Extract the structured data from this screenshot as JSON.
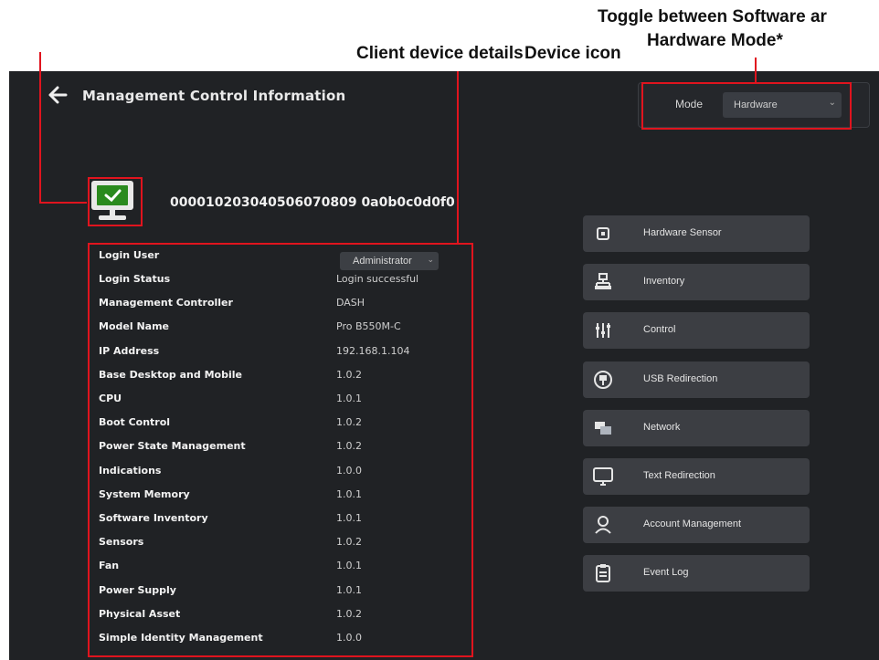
{
  "annotations": {
    "toggle_mode_line1": "Toggle between Software ar",
    "toggle_mode_line2": "Hardware Mode*",
    "client_details": "Client device details",
    "device_icon": "Device icon"
  },
  "colors": {
    "highlight": "#e0141e",
    "screen_bg": "#202225",
    "button_bg": "#3c3e43",
    "accent_green": "#5ecf2e"
  },
  "header": {
    "title": "Management Control Information"
  },
  "mode": {
    "label": "Mode",
    "selected": "Hardware"
  },
  "device": {
    "id": "000010203040506070809 0a0b0c0d0f0"
  },
  "details": {
    "login_user_label": "Login User",
    "login_user_selected": "Administrator",
    "rows": [
      {
        "label": "Login Status",
        "value": "Login successful"
      },
      {
        "label": "Management Controller",
        "value": "DASH"
      },
      {
        "label": "Model Name",
        "value": "Pro B550M-C"
      },
      {
        "label": "IP Address",
        "value": "192.168.1.104"
      },
      {
        "label": "Base Desktop and Mobile",
        "value": "1.0.2"
      },
      {
        "label": "CPU",
        "value": "1.0.1"
      },
      {
        "label": "Boot Control",
        "value": "1.0.2"
      },
      {
        "label": "Power State Management",
        "value": "1.0.2"
      },
      {
        "label": "Indications",
        "value": "1.0.0"
      },
      {
        "label": "System Memory",
        "value": "1.0.1"
      },
      {
        "label": "Software Inventory",
        "value": "1.0.1"
      },
      {
        "label": "Sensors",
        "value": "1.0.2"
      },
      {
        "label": "Fan",
        "value": "1.0.1"
      },
      {
        "label": "Power Supply",
        "value": "1.0.1"
      },
      {
        "label": "Physical Asset",
        "value": "1.0.2"
      },
      {
        "label": "Simple Identity Management",
        "value": "1.0.0"
      }
    ]
  },
  "nav": [
    {
      "label": "Hardware Sensor",
      "icon": "chip-icon"
    },
    {
      "label": "Inventory",
      "icon": "inventory-icon"
    },
    {
      "label": "Control",
      "icon": "sliders-icon"
    },
    {
      "label": "USB Redirection",
      "icon": "usb-icon"
    },
    {
      "label": "Network",
      "icon": "network-icon"
    },
    {
      "label": "Text Redirection",
      "icon": "monitor-icon"
    },
    {
      "label": "Account Management",
      "icon": "user-icon"
    },
    {
      "label": "Event Log",
      "icon": "clipboard-icon"
    }
  ]
}
